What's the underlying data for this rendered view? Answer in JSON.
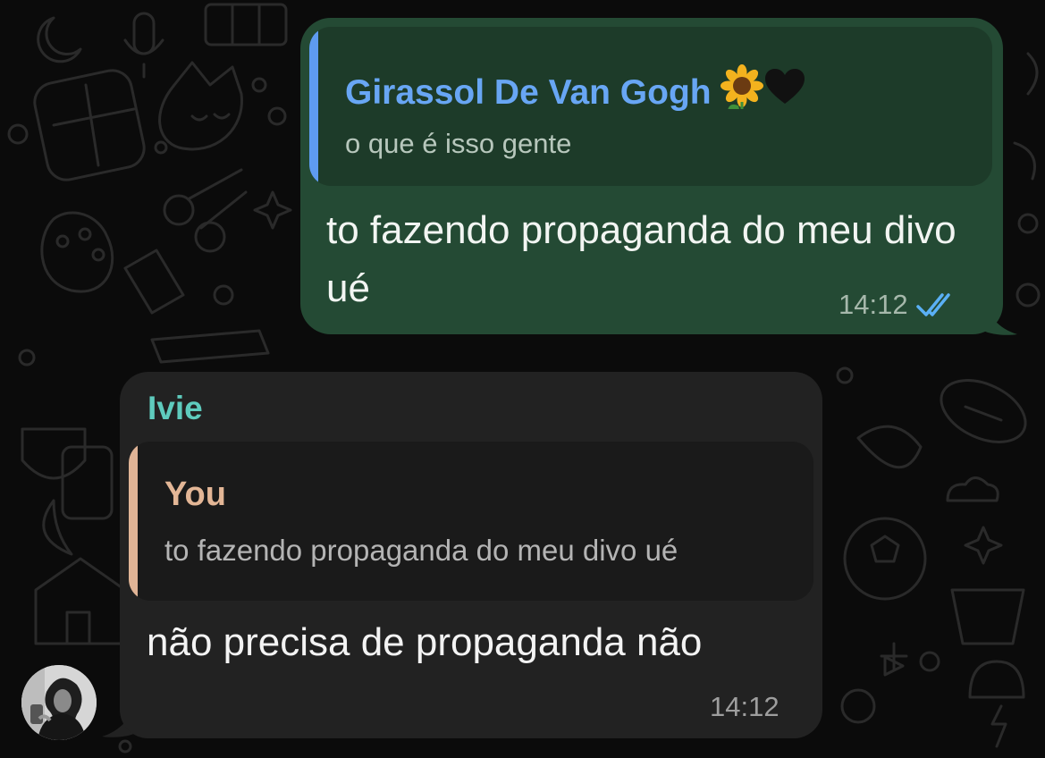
{
  "outgoing": {
    "reply_quote": {
      "author": "Girassol De Van Gogh",
      "author_emojis": "🌻🖤",
      "text": "o que é isso gente"
    },
    "text": "to fazendo propaganda do meu divo ué",
    "time": "14:12",
    "status_icon": "double-check-read-icon"
  },
  "incoming": {
    "sender": "Ivie",
    "reply_quote": {
      "author": "You",
      "text": "to fazendo propaganda do meu divo ué"
    },
    "text": "não precisa de propaganda não",
    "time": "14:12",
    "avatar_icon": "profile-photo-avatar"
  },
  "colors": {
    "background": "#0b0b0b",
    "outgoing_bubble": "#244a34",
    "outgoing_quote": "#1d3b29",
    "outgoing_quote_bar": "#5e9bf0",
    "outgoing_quote_author": "#68a6f4",
    "incoming_bubble": "#222222",
    "incoming_quote": "#1a1a1a",
    "incoming_quote_bar": "#e0b496",
    "incoming_sender": "#5ecbbd",
    "read_check": "#5ab0f5"
  }
}
